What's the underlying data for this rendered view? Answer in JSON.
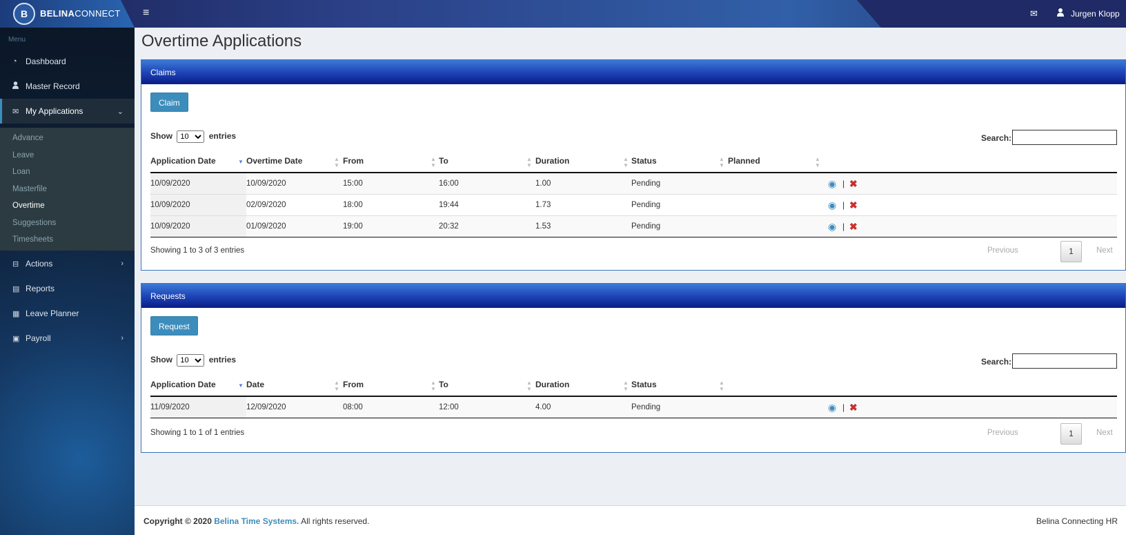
{
  "brand": {
    "bold": "BELINA",
    "rest": "CONNECT",
    "logo_glyph": "B"
  },
  "header": {
    "menu_icon": "≡",
    "mail_icon": "✉",
    "user_icon": "👤",
    "user_name": "Jurgen Klopp"
  },
  "sidebar": {
    "menu_label": "Menu",
    "items": [
      {
        "label": "Dashboard",
        "icon": "dashboard-icon"
      },
      {
        "label": "Master Record",
        "icon": "user-icon"
      },
      {
        "label": "My Applications",
        "icon": "envelope-icon"
      },
      {
        "label": "Actions",
        "icon": "inbox-icon"
      },
      {
        "label": "Reports",
        "icon": "book-icon"
      },
      {
        "label": "Leave Planner",
        "icon": "calendar-icon"
      },
      {
        "label": "Payroll",
        "icon": "money-icon"
      }
    ],
    "submenu": [
      "Advance",
      "Leave",
      "Loan",
      "Masterfile",
      "Overtime",
      "Suggestions",
      "Timesheets"
    ],
    "active_sub": "Overtime"
  },
  "page_title": "Overtime Applications",
  "claims": {
    "title": "Claims",
    "button": "Claim",
    "show": "Show",
    "entries_value": "10",
    "entries": "entries",
    "search_label": "Search:",
    "columns": [
      "Application Date",
      "Overtime Date",
      "From",
      "To",
      "Duration",
      "Status",
      "Planned"
    ],
    "rows": [
      [
        "10/09/2020",
        "10/09/2020",
        "15:00",
        "16:00",
        "1.00",
        "Pending",
        ""
      ],
      [
        "10/09/2020",
        "02/09/2020",
        "18:00",
        "19:44",
        "1.73",
        "Pending",
        ""
      ],
      [
        "10/09/2020",
        "01/09/2020",
        "19:00",
        "20:32",
        "1.53",
        "Pending",
        ""
      ]
    ],
    "info": "Showing 1 to 3 of 3 entries",
    "prev": "Previous",
    "page": "1",
    "next": "Next"
  },
  "requests": {
    "title": "Requests",
    "button": "Request",
    "show": "Show",
    "entries_value": "10",
    "entries": "entries",
    "search_label": "Search:",
    "columns": [
      "Application Date",
      "Date",
      "From",
      "To",
      "Duration",
      "Status"
    ],
    "rows": [
      [
        "11/09/2020",
        "12/09/2020",
        "08:00",
        "12:00",
        "4.00",
        "Pending"
      ]
    ],
    "info": "Showing 1 to 1 of 1 entries",
    "prev": "Previous",
    "page": "1",
    "next": "Next"
  },
  "footer": {
    "copyright": "Copyright © 2020",
    "company": "Belina Time Systems.",
    "rights": "All rights reserved.",
    "right": "Belina Connecting HR"
  },
  "action_sep": "|"
}
